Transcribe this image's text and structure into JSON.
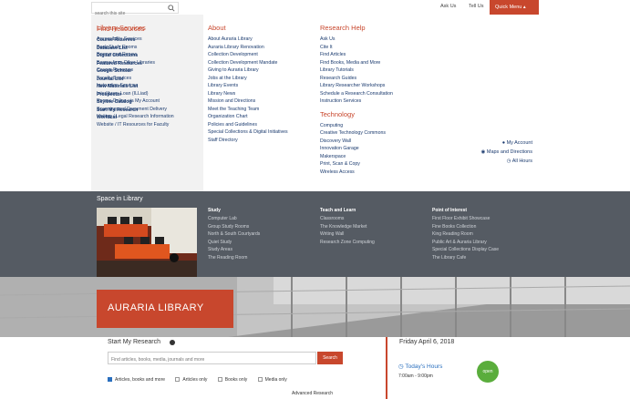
{
  "topbar": {
    "search_placeholder": "search this site",
    "ask_us": "Ask Us",
    "tell_us": "Tell Us",
    "quick_menu": "Quick Menu"
  },
  "menu": {
    "library_services": {
      "title": "Library Services",
      "items": [
        "Accessibility Services",
        "Book Study Rooms",
        "Borrow and Renew",
        "Borrow from Other Libraries",
        "Course Reserves",
        "Faculty Services",
        "Instruction Services",
        "Interlibrary Loan (ILLiad)",
        "Renew Online via My Account",
        "Scanning and Document Delivery",
        "Visiting / Legal Research Information",
        "Website / IT Resources for Faculty"
      ]
    },
    "about": {
      "title": "About",
      "items": [
        "About Auraria Library",
        "Auraria Library Renovation",
        "Collection Development",
        "Collection Development Mandate",
        "Giving to Auraria Library",
        "Jobs at the Library",
        "Library Events",
        "Library News",
        "Mission and Directions",
        "Meet the Teaching Team",
        "Organization Chart",
        "Policies and Guidelines",
        "Special Collections & Digital Initiatives",
        "Staff Directory"
      ]
    },
    "research_help": {
      "title": "Research Help",
      "items": [
        "Ask Us",
        "Cite It",
        "Find Articles",
        "Find Books, Media and More",
        "Library Tutorials",
        "Research Guides",
        "Library Researcher Workshops",
        "Schedule a Research Consultation",
        "Instruction Services"
      ]
    },
    "technology": {
      "title": "Technology",
      "items": [
        "Computing",
        "Creative Technology Commons",
        "Discovery Wall",
        "Innovation Garage",
        "Makerspace",
        "Print, Scan & Copy",
        "Wireless Access"
      ]
    },
    "find_resources": {
      "title": "Find Resources",
      "items": [
        "Course Reserves",
        "Database List",
        "Digital Collections",
        "Featured Resources",
        "Google Scholar",
        "Journal List",
        "New Materials List",
        "Prospector",
        "Skyline Catalog",
        "Start My Research",
        "Worldcat"
      ]
    },
    "account_links": [
      "My Account",
      "Maps and Directions",
      "All Hours"
    ]
  },
  "space": {
    "title": "Space in Library",
    "study": {
      "title": "Study",
      "items": [
        "Computer Lab",
        "Group Study Rooms",
        "North & South Courtyards",
        "Quiet Study",
        "Study Areas",
        "The Reading Room"
      ]
    },
    "teach": {
      "title": "Teach and Learn",
      "items": [
        "Classrooms",
        "The Knowledge Market",
        "Writing Wall",
        "Research Zone Computing"
      ]
    },
    "interest": {
      "title": "Point of Interest",
      "items": [
        "First Floor Exhibit Showcase",
        "Fine Books Collection",
        "King Reading Room",
        "Public Art & Auraria Library",
        "Special Collections Display Case",
        "The Library Cafe"
      ]
    }
  },
  "hero": {
    "logo_text": "AURARIA LIBRARY"
  },
  "research": {
    "title": "Start My Research",
    "placeholder": "Find articles, books, media, journals and more",
    "button": "Search",
    "options": [
      "Articles, books and more",
      "Articles only",
      "Books only",
      "Media only"
    ],
    "advanced": "Advanced Research"
  },
  "hours": {
    "date": "Friday April 6, 2018",
    "label": "Today's Hours",
    "time": "7:00am - 9:00pm",
    "status": "open"
  }
}
